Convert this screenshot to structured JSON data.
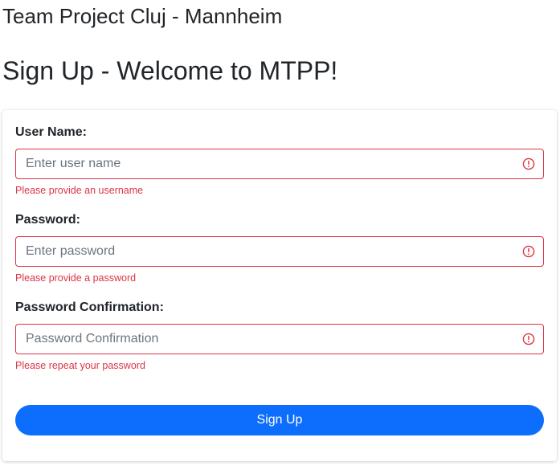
{
  "header": {
    "app_title": "Team Project Cluj - Mannheim",
    "page_title": "Sign Up - Welcome to MTPP!"
  },
  "form": {
    "username": {
      "label": "User Name:",
      "placeholder": "Enter user name",
      "value": "",
      "error": "Please provide an username"
    },
    "password": {
      "label": "Password:",
      "placeholder": "Enter password",
      "value": "",
      "error": "Please provide a password"
    },
    "password_confirmation": {
      "label": "Password Confirmation:",
      "placeholder": "Password Confirmation",
      "value": "",
      "error": "Please repeat your password"
    },
    "submit_label": "Sign Up"
  },
  "colors": {
    "error": "#dc3545",
    "primary": "#0d6efd",
    "text": "#212529"
  },
  "icons": {
    "invalid_field": "exclamation-circle-icon"
  }
}
